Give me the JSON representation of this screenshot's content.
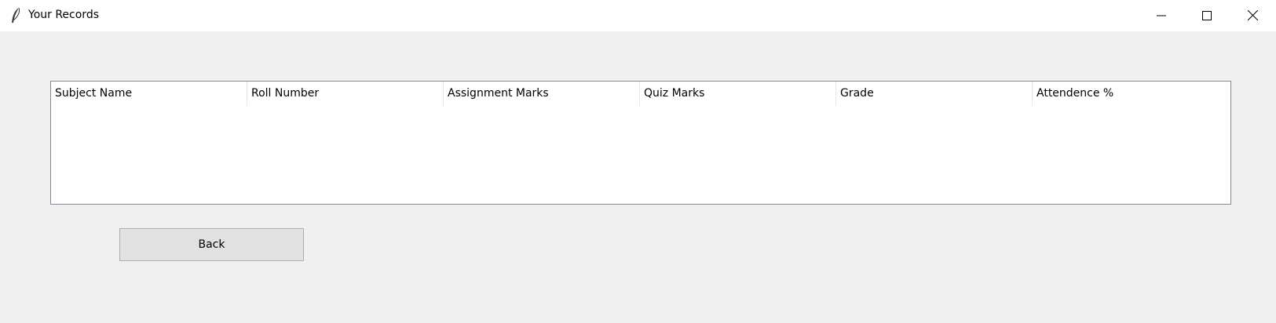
{
  "window": {
    "title": "Your Records",
    "icon": "feather-icon"
  },
  "controls": {
    "minimize_icon": "minimize-icon",
    "maximize_icon": "maximize-icon",
    "close_icon": "close-icon"
  },
  "table": {
    "columns": [
      "Subject Name",
      "Roll Number",
      "Assignment Marks",
      "Quiz Marks",
      "Grade",
      "Attendence %"
    ],
    "rows": []
  },
  "buttons": {
    "back_label": "Back"
  }
}
